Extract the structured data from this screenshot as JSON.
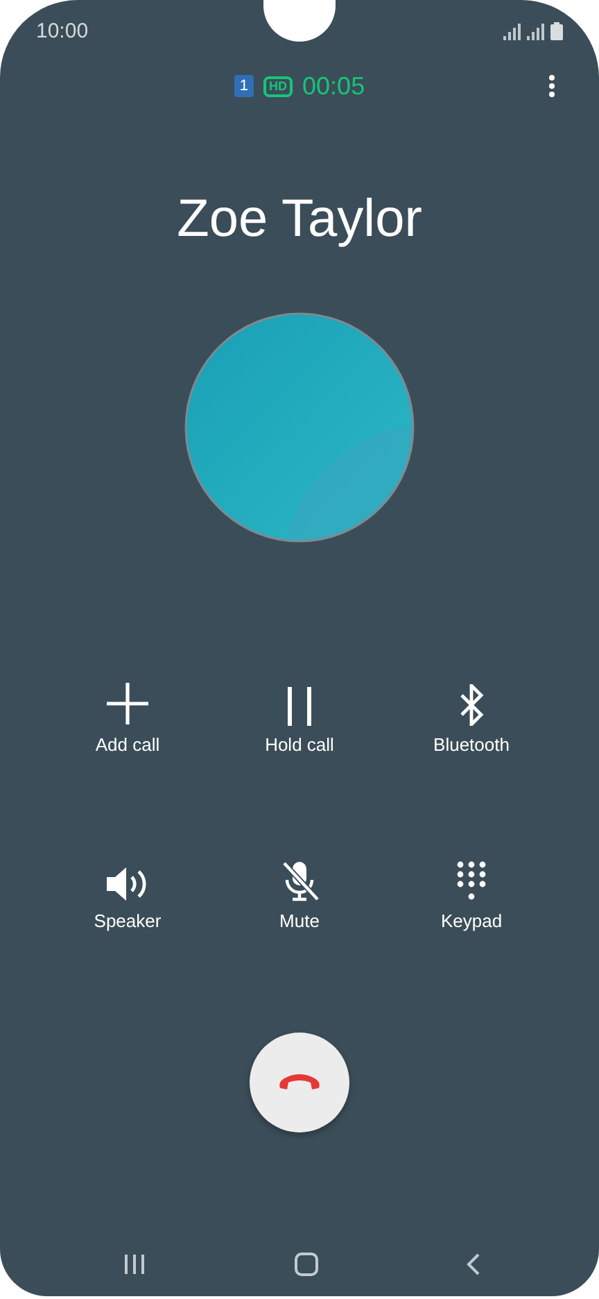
{
  "status_bar": {
    "time": "10:00"
  },
  "call_info": {
    "sim": "1",
    "hd": "HD",
    "duration": "00:05"
  },
  "contact": {
    "name": "Zoe Taylor"
  },
  "actions": [
    {
      "kind": "add",
      "label": "Add call"
    },
    {
      "kind": "hold",
      "label": "Hold call"
    },
    {
      "kind": "bluetooth",
      "label": "Bluetooth"
    },
    {
      "kind": "speaker",
      "label": "Speaker"
    },
    {
      "kind": "mute",
      "label": "Mute"
    },
    {
      "kind": "keypad",
      "label": "Keypad"
    }
  ]
}
